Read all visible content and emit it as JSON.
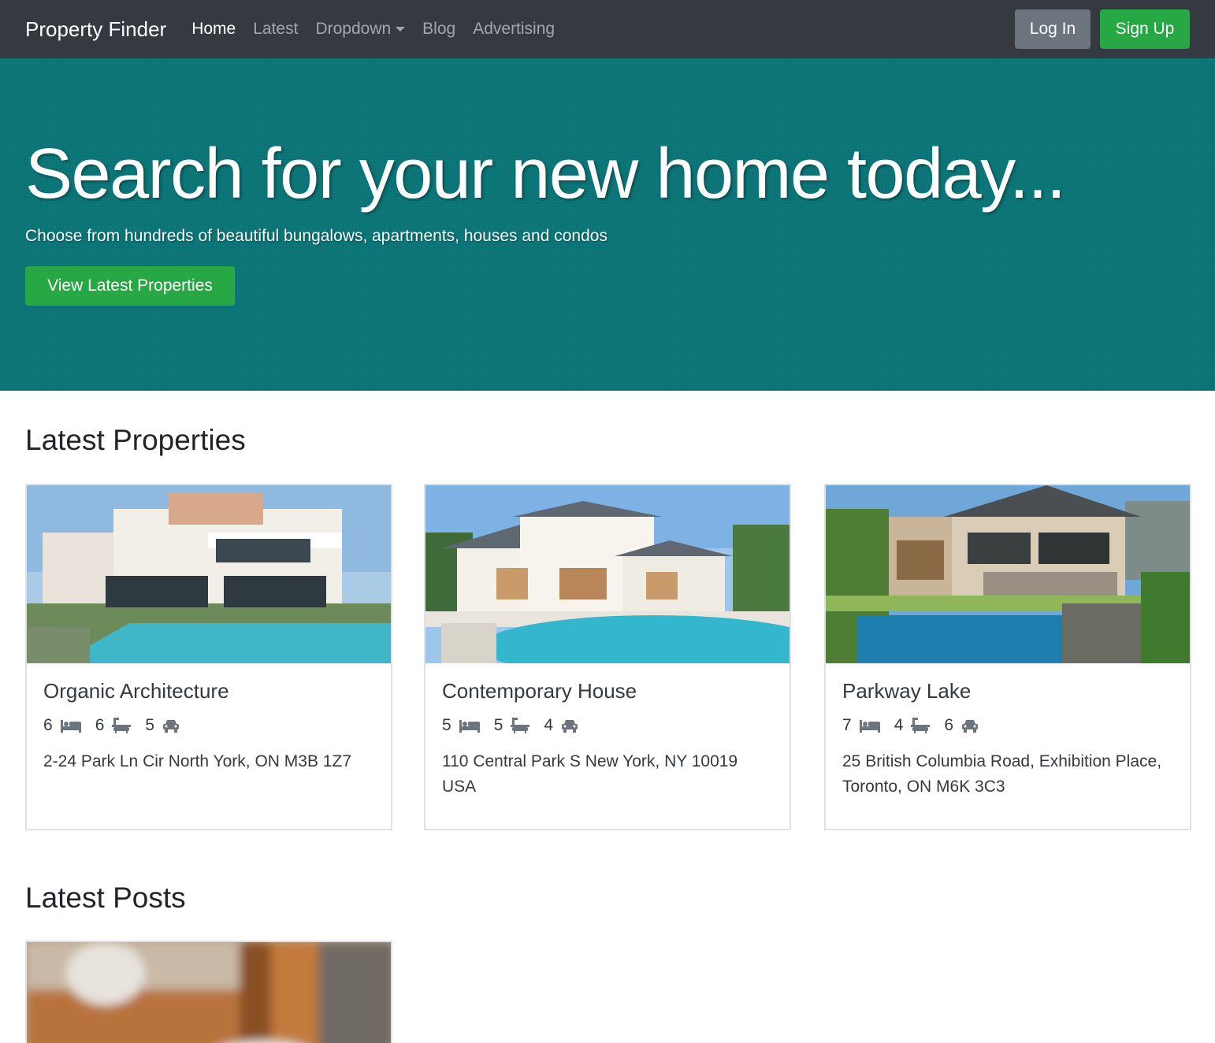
{
  "navbar": {
    "brand": "Property Finder",
    "links": [
      {
        "label": "Home"
      },
      {
        "label": "Latest"
      },
      {
        "label": "Dropdown"
      },
      {
        "label": "Blog"
      },
      {
        "label": "Advertising"
      }
    ],
    "login_label": "Log In",
    "signup_label": "Sign Up"
  },
  "hero": {
    "title": "Search for your new home today...",
    "subtitle": "Choose from hundreds of beautiful bungalows, apartments, houses and condos",
    "cta_label": "View Latest Properties"
  },
  "latest_properties": {
    "heading": "Latest Properties",
    "items": [
      {
        "title": "Organic Architecture",
        "beds": "6",
        "baths": "6",
        "cars": "5",
        "address": "2-24 Park Ln Cir North York, ON M3B 1Z7"
      },
      {
        "title": "Contemporary House",
        "beds": "5",
        "baths": "5",
        "cars": "4",
        "address": "110 Central Park S New York, NY 10019 USA"
      },
      {
        "title": "Parkway Lake",
        "beds": "7",
        "baths": "4",
        "cars": "6",
        "address": "25 British Columbia Road, Exhibition Place, Toronto, ON M6K 3C3"
      }
    ]
  },
  "latest_posts": {
    "heading": "Latest Posts"
  },
  "icons": {
    "bed": "bed-icon",
    "bath": "bath-icon",
    "car": "car-icon",
    "dropdown": "caret-down-icon"
  },
  "colors": {
    "navbar": "#343a40",
    "hero": "#0b7476",
    "success": "#28a745",
    "secondary": "#6c757d"
  }
}
